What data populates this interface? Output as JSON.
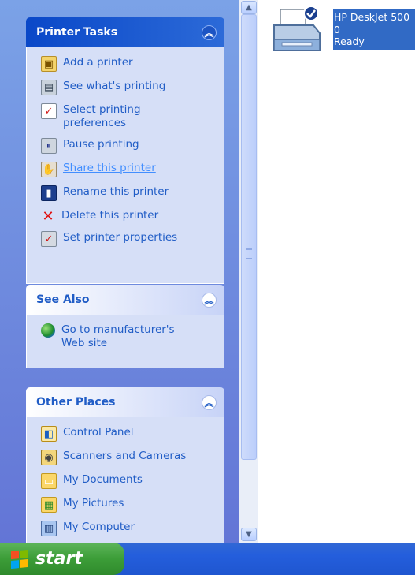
{
  "printer_tasks": {
    "title": "Printer Tasks",
    "items": [
      {
        "label": "Add a printer",
        "icon": "add-printer-icon"
      },
      {
        "label": "See what's printing",
        "icon": "print-queue-icon"
      },
      {
        "label": "Select printing\npreferences",
        "icon": "preferences-icon"
      },
      {
        "label": "Pause printing",
        "icon": "pause-printer-icon"
      },
      {
        "label": "Share this printer",
        "icon": "share-printer-icon"
      },
      {
        "label": "Rename this printer",
        "icon": "rename-icon"
      },
      {
        "label": "Delete this printer",
        "icon": "delete-icon"
      },
      {
        "label": "Set printer properties",
        "icon": "printer-properties-icon"
      }
    ]
  },
  "see_also": {
    "title": "See Also",
    "items": [
      {
        "label": "Go to manufacturer's\nWeb site",
        "icon": "globe-icon"
      }
    ]
  },
  "other_places": {
    "title": "Other Places",
    "items": [
      {
        "label": "Control Panel",
        "icon": "control-panel-icon"
      },
      {
        "label": "Scanners and Cameras",
        "icon": "scanner-icon"
      },
      {
        "label": "My Documents",
        "icon": "folder-icon"
      },
      {
        "label": "My Pictures",
        "icon": "pictures-folder-icon"
      },
      {
        "label": "My Computer",
        "icon": "computer-icon"
      }
    ]
  },
  "printer": {
    "name": "HP DeskJet 500",
    "documents": "0",
    "status": "Ready"
  },
  "taskbar": {
    "start_label": "start"
  },
  "colors": {
    "task_pane_top": "#7ba2e7",
    "special_header": "#0a48c8",
    "panel_body": "#d6dff7",
    "link": "#215dc6",
    "selection": "#316ac5",
    "taskbar": "#245edc",
    "start_button": "#3c9d38"
  }
}
